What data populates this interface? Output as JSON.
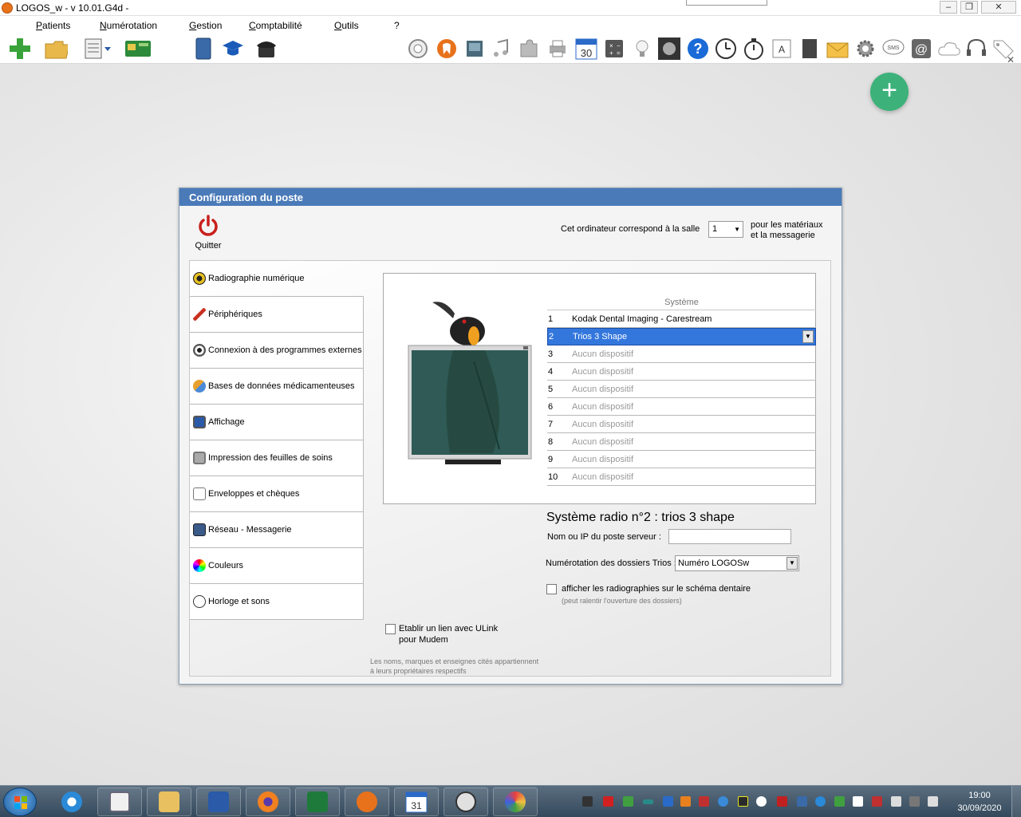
{
  "app": {
    "title": "LOGOS_w - v 10.01.G4d  -"
  },
  "menu": {
    "items": [
      "Patients",
      "Numérotation",
      "Gestion",
      "Comptabilité",
      "Outils",
      "?"
    ]
  },
  "toolbar": {
    "calendar_day": "30",
    "font_icon_letter": "A"
  },
  "dialog": {
    "title": "Configuration du poste",
    "quit_label": "Quitter",
    "salle_label": "Cet ordinateur correspond à la salle",
    "salle_value": "1",
    "salle_suffix": "pour les matériaux et la messagerie",
    "nav": [
      {
        "label": "Radiographie numérique",
        "icon": "radiation-icon"
      },
      {
        "label": "Périphériques",
        "icon": "cable-plug-icon"
      },
      {
        "label": "Connexion à des programmes externes",
        "icon": "eye-icon"
      },
      {
        "label": "Bases de données médicamenteuses",
        "icon": "pill-icon"
      },
      {
        "label": "Affichage",
        "icon": "monitor-icon"
      },
      {
        "label": "Impression des feuilles de soins",
        "icon": "printer-icon"
      },
      {
        "label": "Enveloppes et chèques",
        "icon": "envelope-icon"
      },
      {
        "label": "Réseau - Messagerie",
        "icon": "network-icon"
      },
      {
        "label": "Couleurs",
        "icon": "color-wheel-icon"
      },
      {
        "label": "Horloge et sons",
        "icon": "clock-icon"
      }
    ],
    "systems_table": {
      "header": "Système",
      "rows": [
        {
          "num": "1",
          "system": "Kodak Dental Imaging - Carestream"
        },
        {
          "num": "2",
          "system": "Trios 3 Shape"
        },
        {
          "num": "3",
          "system": "Aucun dispositif"
        },
        {
          "num": "4",
          "system": "Aucun dispositif"
        },
        {
          "num": "5",
          "system": "Aucun dispositif"
        },
        {
          "num": "6",
          "system": "Aucun dispositif"
        },
        {
          "num": "7",
          "system": "Aucun dispositif"
        },
        {
          "num": "8",
          "system": "Aucun dispositif"
        },
        {
          "num": "9",
          "system": "Aucun dispositif"
        },
        {
          "num": "10",
          "system": "Aucun dispositif"
        }
      ]
    },
    "radio_system_title": "Système radio n°2 : trios 3 shape",
    "server_label": "Nom ou IP du poste serveur :",
    "server_value": "",
    "numbering_label": "Numérotation des dossiers Trios :",
    "numbering_value": "Numéro LOGOSw",
    "show_radios_label": "afficher les radiographies sur le schéma dentaire",
    "show_radios_note": "(peut ralentir l'ouverture des dossiers)",
    "ulink_label_1": "Etablir un lien avec ULink",
    "ulink_label_2": "pour Mudem",
    "disclaimer_1": "Les noms, marques et enseignes cités appartiennent",
    "disclaimer_2": "à leurs propriétaires respectifs"
  },
  "taskbar": {
    "calendar_day": "31",
    "time": "19:00",
    "date": "30/09/2020"
  },
  "colors": {
    "accent": "#4a7ab8",
    "selection": "#3377dd",
    "fab": "#3cb27a",
    "quit": "#c8201c"
  }
}
